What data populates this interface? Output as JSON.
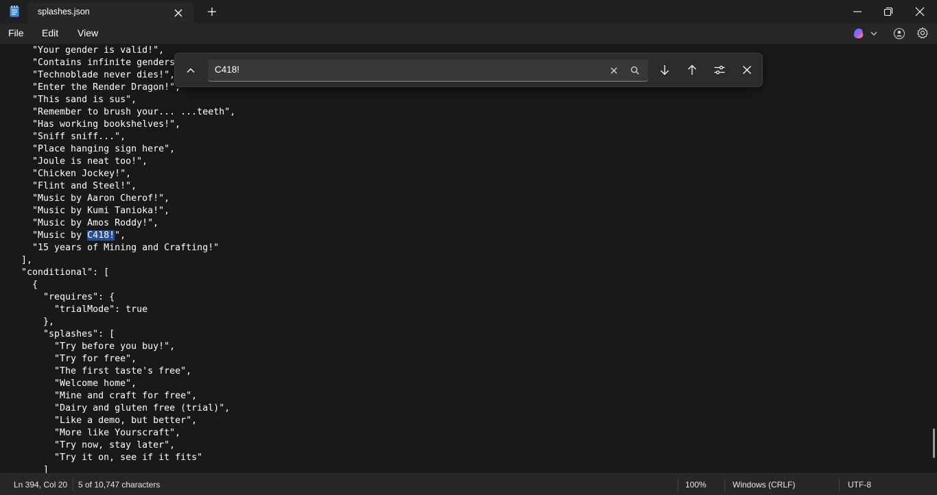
{
  "window": {
    "tab_title": "splashes.json"
  },
  "menu": {
    "file": "File",
    "edit": "Edit",
    "view": "View"
  },
  "find": {
    "query": "C418!"
  },
  "editor": {
    "lines": [
      {
        "pre": "    \"Your gender is valid!\",",
        "hl": "",
        "post": ""
      },
      {
        "pre": "    \"Contains infinite genders",
        "hl": "",
        "post": ""
      },
      {
        "pre": "    \"Technoblade never dies!\",",
        "hl": "",
        "post": ""
      },
      {
        "pre": "    \"Enter the Render Dragon!\",",
        "hl": "",
        "post": ""
      },
      {
        "pre": "    \"This sand is sus\",",
        "hl": "",
        "post": ""
      },
      {
        "pre": "    \"Remember to brush your... ...teeth\",",
        "hl": "",
        "post": ""
      },
      {
        "pre": "    \"Has working bookshelves!\",",
        "hl": "",
        "post": ""
      },
      {
        "pre": "    \"Sniff sniff...\",",
        "hl": "",
        "post": ""
      },
      {
        "pre": "    \"Place hanging sign here\",",
        "hl": "",
        "post": ""
      },
      {
        "pre": "    \"Joule is neat too!\",",
        "hl": "",
        "post": ""
      },
      {
        "pre": "    \"Chicken Jockey!\",",
        "hl": "",
        "post": ""
      },
      {
        "pre": "    \"Flint and Steel!\",",
        "hl": "",
        "post": ""
      },
      {
        "pre": "    \"Music by Aaron Cherof!\",",
        "hl": "",
        "post": ""
      },
      {
        "pre": "    \"Music by Kumi Tanioka!\",",
        "hl": "",
        "post": ""
      },
      {
        "pre": "    \"Music by Amos Roddy!\",",
        "hl": "",
        "post": ""
      },
      {
        "pre": "    \"Music by ",
        "hl": "C418!",
        "post": "\","
      },
      {
        "pre": "    \"15 years of Mining and Crafting!\"",
        "hl": "",
        "post": ""
      },
      {
        "pre": "  ],",
        "hl": "",
        "post": ""
      },
      {
        "pre": "  \"conditional\": [",
        "hl": "",
        "post": ""
      },
      {
        "pre": "    {",
        "hl": "",
        "post": ""
      },
      {
        "pre": "      \"requires\": {",
        "hl": "",
        "post": ""
      },
      {
        "pre": "        \"trialMode\": true",
        "hl": "",
        "post": ""
      },
      {
        "pre": "      },",
        "hl": "",
        "post": ""
      },
      {
        "pre": "      \"splashes\": [",
        "hl": "",
        "post": ""
      },
      {
        "pre": "        \"Try before you buy!\",",
        "hl": "",
        "post": ""
      },
      {
        "pre": "        \"Try for free\",",
        "hl": "",
        "post": ""
      },
      {
        "pre": "        \"The first taste's free\",",
        "hl": "",
        "post": ""
      },
      {
        "pre": "        \"Welcome home\",",
        "hl": "",
        "post": ""
      },
      {
        "pre": "        \"Mine and craft for free\",",
        "hl": "",
        "post": ""
      },
      {
        "pre": "        \"Dairy and gluten free (trial)\",",
        "hl": "",
        "post": ""
      },
      {
        "pre": "        \"Like a demo, but better\",",
        "hl": "",
        "post": ""
      },
      {
        "pre": "        \"More like Yourscraft\",",
        "hl": "",
        "post": ""
      },
      {
        "pre": "        \"Try now, stay later\",",
        "hl": "",
        "post": ""
      },
      {
        "pre": "        \"Try it on, see if it fits\"",
        "hl": "",
        "post": ""
      },
      {
        "pre": "      ]",
        "hl": "",
        "post": ""
      }
    ]
  },
  "status": {
    "position": "Ln 394, Col 20",
    "selection": "5 of 10,747 characters",
    "zoom": "100%",
    "line_ending": "Windows (CRLF)",
    "encoding": "UTF-8"
  },
  "colors": {
    "editor_bg": "#191919",
    "chrome_bg": "#272727",
    "selection": "#264f9a",
    "copilot_accent": "#a259ff"
  }
}
